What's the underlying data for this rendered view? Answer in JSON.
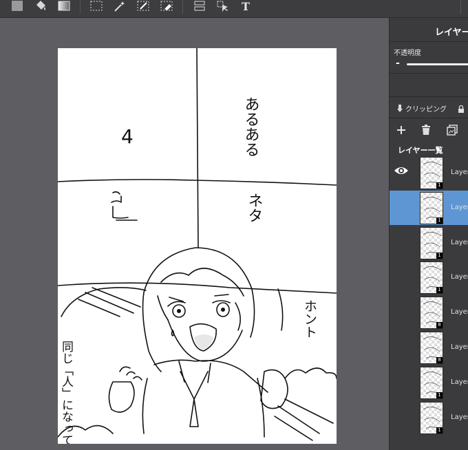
{
  "toolbar": {
    "icons": [
      "fill-color-icon",
      "paint-bucket-icon",
      "gradient-icon",
      "select-rect-icon",
      "magic-wand-icon",
      "select-pen-icon",
      "select-eraser-icon",
      "layer-move-icon",
      "move-tool-icon",
      "text-tool-icon"
    ],
    "text_tool_label": "T"
  },
  "layers_panel": {
    "title": "レイヤー",
    "opacity_label": "不透明度",
    "opacity_minus": "-",
    "clipping_label": "クリッピング",
    "list_title": "レイヤー一覧",
    "accent_color": "#5d96d3",
    "layers": [
      {
        "name": "Layer",
        "badge": "1",
        "visible": true,
        "selected": false
      },
      {
        "name": "Layer",
        "badge": "1",
        "visible": false,
        "selected": true
      },
      {
        "name": "Layer",
        "badge": "1",
        "visible": false,
        "selected": false
      },
      {
        "name": "Layer",
        "badge": "1",
        "visible": false,
        "selected": false
      },
      {
        "name": "Layer",
        "badge": "8",
        "visible": false,
        "selected": false
      },
      {
        "name": "Layer",
        "badge": "8",
        "visible": false,
        "selected": false
      },
      {
        "name": "Layer",
        "badge": "1",
        "visible": false,
        "selected": false
      },
      {
        "name": "Layer",
        "badge": "1",
        "visible": false,
        "selected": false
      }
    ]
  },
  "canvas": {
    "panel1_text": "4",
    "panel2_text": "あるある",
    "panel3_text": "ネタ",
    "panel5_side_text": "ホント",
    "panel5_left_text": "同じ「人」になってみな"
  }
}
